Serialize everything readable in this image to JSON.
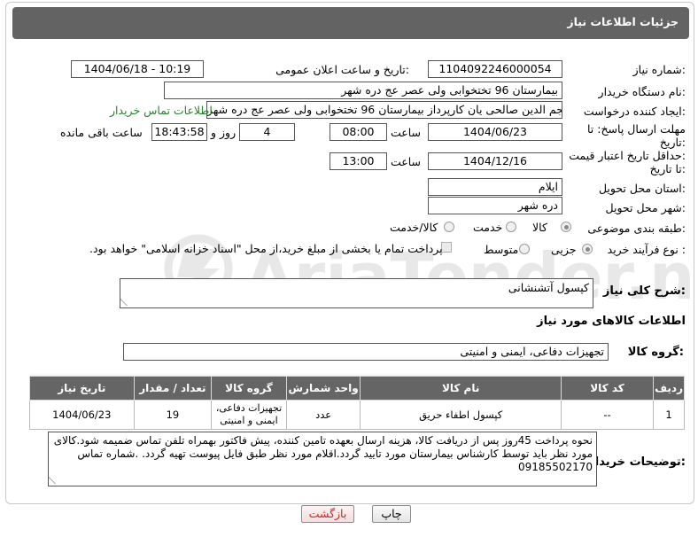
{
  "header": {
    "title": "جزئیات اطلاعات نیاز"
  },
  "labels": {
    "need_number": "شماره نیاز:",
    "announce_datetime": "تاریخ و ساعت اعلان عمومی:",
    "buyer_org": "نام دستگاه خریدار:",
    "requester": "ایجاد کننده درخواست:",
    "reply_deadline_1": "مهلت ارسال پاسخ: تا",
    "reply_deadline_2": "تاریخ:",
    "price_validity_1": "حداقل تاریخ اعتبار قیمت:",
    "price_validity_2": "تا تاریخ:",
    "hour": "ساعت",
    "day_and": "روز و",
    "hours_left": "ساعت باقی مانده",
    "delivery_province": "استان محل تحویل:",
    "delivery_city": "شهر محل تحویل:",
    "category": "طبقه بندی موضوعی:",
    "purchase_type": "نوع فرآیند خرید :",
    "need_description": "شرح کلی نیاز:",
    "goods_info": "اطلاعات کالاهای مورد نیاز",
    "goods_group": "گروه کالا:",
    "buyer_notes": "توضیحات خریدار:"
  },
  "fields": {
    "need_number": "1104092246000054",
    "announce_datetime": "1404/06/18 - 10:19",
    "buyer_org": "بیمارستان 96 تختخوابی ولی عصر عج دره شهر",
    "requester": "نجم الدین صالحی یان کارپرداز بیمارستان 96 تختخوابی ولی عصر عج دره شهر",
    "buyer_contact_link": "اطلاعات تماس خریدار",
    "reply_date": "1404/06/23",
    "reply_time": "08:00",
    "days_left": "4",
    "time_left": "18:43:58",
    "validity_date": "1404/12/16",
    "validity_time": "13:00",
    "province": "ایلام",
    "city": "دره شهر",
    "need_description": "کپسول آتشنشانی",
    "goods_group": "تجهیزات دفاعی، ایمنی و امنیتی",
    "buyer_notes": "نحوه پرداخت 45روز پس از دریافت کالا، هزینه ارسال بعهده تامین کننده،  پیش فاکتور بهمراه تلفن تماس ضمیمه شود.کالای مورد نظر باید توسط کارشناس بیمارستان مورد تایید گردد.اقلام مورد نظر طبق فایل پیوست تهیه گردد. .شماره تماس 09185502170"
  },
  "category_options": [
    {
      "label": "کالا",
      "selected": true
    },
    {
      "label": "خدمت",
      "selected": false
    },
    {
      "label": "کالا/خدمت",
      "selected": false
    }
  ],
  "purchase_options": [
    {
      "label": "جزیی",
      "selected": true
    },
    {
      "label": "متوسط",
      "selected": false
    }
  ],
  "payment_note": "پرداخت تمام یا بخشی از مبلغ خرید،از محل \"اسناد خزانه اسلامی\" خواهد بود.",
  "table": {
    "headers": [
      "ردیف",
      "کد کالا",
      "نام کالا",
      "واحد شمارش",
      "گروه کالا",
      "تعداد / مقدار",
      "تاریخ نیاز"
    ],
    "rows": [
      [
        "1",
        "--",
        "کپسول اطفاء حریق",
        "عدد",
        "تجهیزات دفاعی، ایمنی و امنیتی",
        "19",
        "1404/06/23"
      ]
    ]
  },
  "buttons": {
    "print": "چاپ",
    "back": "بازگشت"
  },
  "watermark": "AriaTender.net",
  "colors": {
    "header_bg": "#636363",
    "link": "#2e7d32",
    "back_button_text": "#c62828"
  }
}
